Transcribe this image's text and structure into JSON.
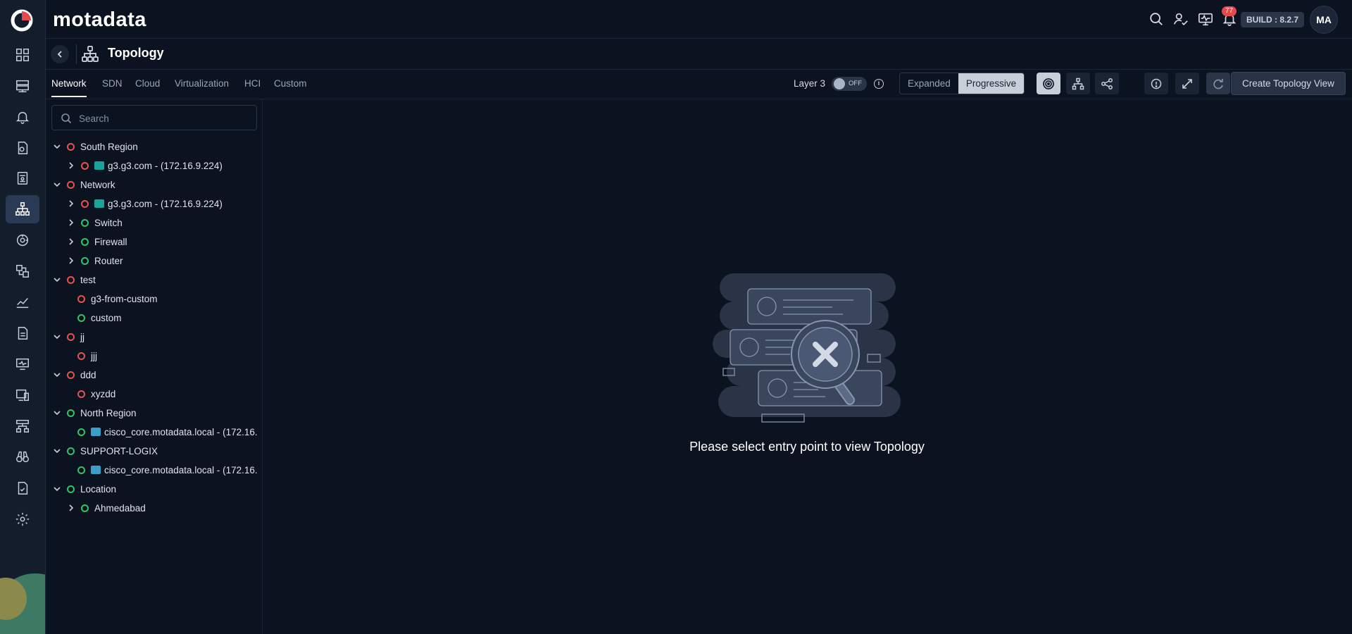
{
  "app": {
    "brand": "motadata",
    "build": "BUILD : 8.2.7",
    "user_initials": "MA",
    "notification_count": "77"
  },
  "rail": {
    "items": [
      "dashboard-icon",
      "monitor-icon",
      "alert-bell-icon",
      "policy-icon",
      "inventory-icon",
      "topology-icon",
      "discovery-icon",
      "flow-icon",
      "metrics-icon",
      "report-icon",
      "screen-icon",
      "device-icon",
      "network-icon",
      "binocular-icon",
      "audit-icon",
      "settings-icon"
    ],
    "active_index": 5
  },
  "header": {
    "title": "Topology"
  },
  "tabs": [
    {
      "label": "Network",
      "active": true
    },
    {
      "label": "SDN",
      "active": false
    },
    {
      "label": "Cloud",
      "active": false
    },
    {
      "label": "Virtualization",
      "active": false
    },
    {
      "label": "HCI",
      "active": false
    },
    {
      "label": "Custom",
      "active": false
    }
  ],
  "toolbar": {
    "layer_label": "Layer 3",
    "layer_toggle": "OFF",
    "view_modes": [
      "Expanded",
      "Progressive"
    ],
    "selected_view_mode": "Progressive",
    "create_label": "Create Topology View"
  },
  "search": {
    "placeholder": "Search"
  },
  "tree": [
    {
      "label": "South Region",
      "status": "down",
      "level": 0,
      "expander": "open"
    },
    {
      "label": "g3.g3.com - (172.16.9.224)",
      "status": "down",
      "level": 1,
      "expander": "closed",
      "device": true
    },
    {
      "label": "Network",
      "status": "down",
      "level": 0,
      "expander": "open"
    },
    {
      "label": "g3.g3.com - (172.16.9.224)",
      "status": "down",
      "level": 1,
      "expander": "closed",
      "device": true
    },
    {
      "label": "Switch",
      "status": "up",
      "level": 1,
      "expander": "closed"
    },
    {
      "label": "Firewall",
      "status": "up",
      "level": 1,
      "expander": "closed"
    },
    {
      "label": "Router",
      "status": "up",
      "level": 1,
      "expander": "closed"
    },
    {
      "label": "test",
      "status": "down",
      "level": 0,
      "expander": "open"
    },
    {
      "label": "g3-from-custom",
      "status": "down",
      "level": 1,
      "expander": "none"
    },
    {
      "label": "custom",
      "status": "up",
      "level": 1,
      "expander": "none"
    },
    {
      "label": "jj",
      "status": "down",
      "level": 0,
      "expander": "open"
    },
    {
      "label": "jjj",
      "status": "down",
      "level": 1,
      "expander": "none"
    },
    {
      "label": "ddd",
      "status": "down",
      "level": 0,
      "expander": "open"
    },
    {
      "label": "xyzdd",
      "status": "down",
      "level": 1,
      "expander": "none"
    },
    {
      "label": "North Region",
      "status": "up",
      "level": 0,
      "expander": "open"
    },
    {
      "label": "cisco_core.motadata.local - (172.16.",
      "status": "up",
      "level": 1,
      "expander": "none",
      "device": true
    },
    {
      "label": "SUPPORT-LOGIX",
      "status": "up",
      "level": 0,
      "expander": "open"
    },
    {
      "label": "cisco_core.motadata.local - (172.16.",
      "status": "up",
      "level": 1,
      "expander": "none",
      "device": true
    },
    {
      "label": "Location",
      "status": "up",
      "level": 0,
      "expander": "open"
    },
    {
      "label": "Ahmedabad",
      "status": "up",
      "level": 1,
      "expander": "closed"
    }
  ],
  "empty_state": {
    "message": "Please select entry point to view Topology"
  },
  "colors": {
    "status_down": "#e5534b",
    "status_up": "#30c463",
    "background": "#0b1220"
  }
}
